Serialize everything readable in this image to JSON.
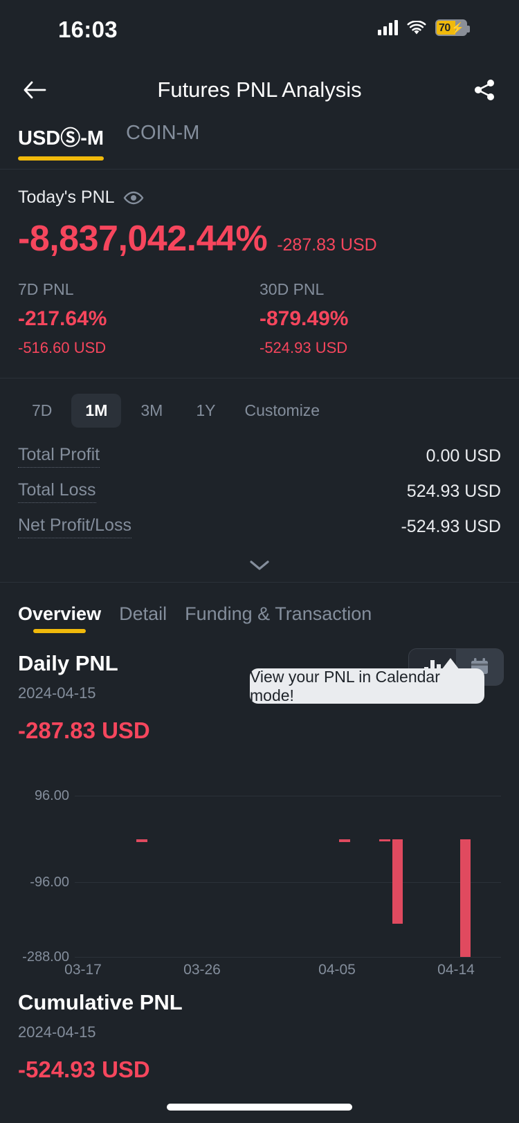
{
  "status_bar": {
    "time": "16:03",
    "battery_percent": "70",
    "icons": [
      "cellular-signal-icon",
      "wifi-icon",
      "battery-charging-icon"
    ]
  },
  "nav": {
    "back_icon": "arrow-left-icon",
    "title": "Futures PNL Analysis",
    "share_icon": "share-icon"
  },
  "top_tabs": [
    {
      "label": "USDⓈ-M",
      "active": true
    },
    {
      "label": "COIN-M",
      "active": false
    }
  ],
  "summary": {
    "label": "Today's PNL",
    "visibility_icon": "eye-icon",
    "percent": "-8,837,042.44%",
    "amount": "-287.83 USD",
    "columns": [
      {
        "label": "7D PNL",
        "percent": "-217.64%",
        "amount": "-516.60 USD"
      },
      {
        "label": "30D PNL",
        "percent": "-879.49%",
        "amount": "-524.93 USD"
      }
    ]
  },
  "ranges": [
    {
      "label": "7D",
      "active": false
    },
    {
      "label": "1M",
      "active": true
    },
    {
      "label": "3M",
      "active": false
    },
    {
      "label": "1Y",
      "active": false
    },
    {
      "label": "Customize",
      "active": false
    }
  ],
  "stats": [
    {
      "key": "Total Profit",
      "value": "0.00 USD"
    },
    {
      "key": "Total Loss",
      "value": "524.93 USD"
    },
    {
      "key": "Net Profit/Loss",
      "value": "-524.93 USD"
    }
  ],
  "expand_icon": "chevron-down-icon",
  "section_tabs": [
    {
      "label": "Overview",
      "active": true
    },
    {
      "label": "Detail",
      "active": false
    },
    {
      "label": "Funding & Transaction",
      "active": false
    }
  ],
  "daily_pnl": {
    "title": "Daily PNL",
    "date": "2024-04-15",
    "value": "-287.83 USD",
    "view_toggle": {
      "chart_icon": "bar-chart-icon",
      "calendar_icon": "calendar-icon",
      "selected": "chart"
    },
    "tooltip": "View your PNL in Calendar mode!"
  },
  "cumulative_pnl": {
    "title": "Cumulative PNL",
    "date": "2024-04-15",
    "value": "-524.93 USD"
  },
  "colors": {
    "background": "#1e2329",
    "loss_red": "#f6465d",
    "bar_red": "#e04a5f",
    "accent_yellow": "#f0b90b",
    "muted_text": "#848e9c",
    "primary_text": "#eaecef"
  },
  "chart_data": {
    "type": "bar",
    "title": "Daily PNL",
    "xlabel": "",
    "ylabel": "",
    "ylim": [
      -288,
      96
    ],
    "yticks": [
      96.0,
      -96.0,
      -288.0
    ],
    "ytick_labels": [
      "96.00",
      "-96.00",
      "-288.00"
    ],
    "xtick_labels": [
      "03-17",
      "03-26",
      "04-05",
      "04-14"
    ],
    "grid": true,
    "legend": false,
    "zero_baseline": 0,
    "bars": [
      {
        "x": "03-22",
        "value": -4
      },
      {
        "x": "04-06",
        "value": -4
      },
      {
        "x": "04-08",
        "value": -3
      },
      {
        "x": "04-09",
        "value": -216
      },
      {
        "x": "04-15",
        "value": -288
      }
    ]
  }
}
